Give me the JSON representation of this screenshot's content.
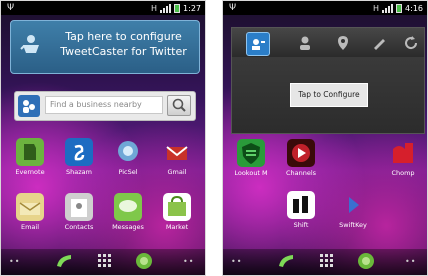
{
  "left_screen": {
    "status": {
      "time": "1:27"
    },
    "tweetcaster_widget": {
      "line1": "Tap here to configure",
      "line2": "TweetCaster for Twitter"
    },
    "search_widget": {
      "placeholder": "Find a business nearby"
    },
    "apps": [
      {
        "label": "Evernote",
        "color": "#6cb33f"
      },
      {
        "label": "Shazam",
        "color": "#1c6cc2"
      },
      {
        "label": "PicSel",
        "color": "#6fa7d6"
      },
      {
        "label": "Gmail",
        "color": "#c8322a"
      },
      {
        "label": "Email",
        "color": "#e7d48b"
      },
      {
        "label": "Contacts",
        "color": "#cfcfcf"
      },
      {
        "label": "Messages",
        "color": "#7fc84a"
      },
      {
        "label": "Market",
        "color": "#ffffff"
      }
    ]
  },
  "right_screen": {
    "status": {
      "time": "4:16"
    },
    "toolbar_icons": [
      "account-icon",
      "person-icon",
      "location-icon",
      "pen-icon",
      "refresh-icon"
    ],
    "config_prompt": "Tap to Configure",
    "apps": [
      {
        "label": "Lookout M",
        "color": "#2a9b3a"
      },
      {
        "label": "Channels",
        "color": "#c0202a"
      },
      {
        "label": "Chomp",
        "color": "#d61f2c"
      },
      {
        "label": "Shift",
        "color": "#ffffff"
      },
      {
        "label": "SwiftKey",
        "color": "#3a6fd0"
      }
    ]
  }
}
